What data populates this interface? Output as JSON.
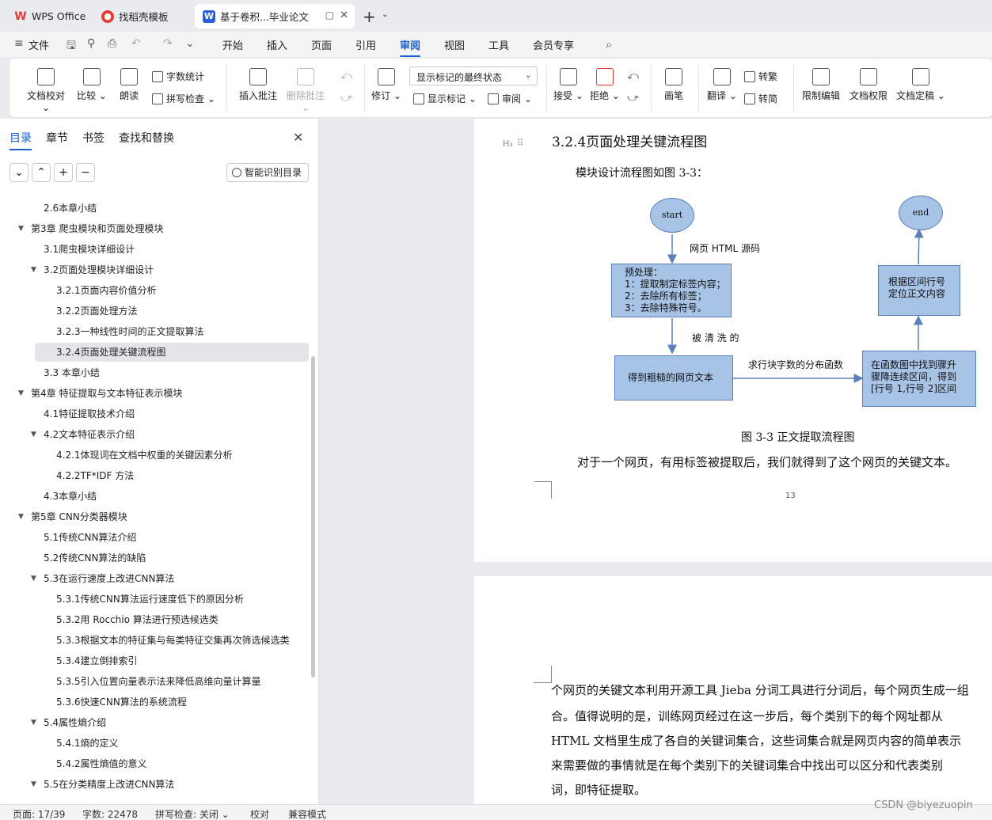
{
  "tabs": [
    {
      "label": "WPS Office",
      "icon": "wps-logo-icon",
      "color": "#e53935"
    },
    {
      "label": "找稻壳模板",
      "icon": "docer-icon",
      "color": "#e53935"
    },
    {
      "label": "基于卷积...毕业论文",
      "icon": "word-doc-icon",
      "color": "#2b5fd9"
    }
  ],
  "menu": {
    "file": "文件",
    "items": [
      "开始",
      "插入",
      "页面",
      "引用",
      "审阅",
      "视图",
      "工具",
      "会员专享"
    ],
    "active": "审阅"
  },
  "ribbon": {
    "proofread": "文档校对",
    "compare": "比较",
    "read_aloud": "朗读",
    "word_count": "字数统计",
    "spell_check": "拼写检查",
    "insert_comment": "插入批注",
    "delete_comment": "删除批注",
    "track_changes": "修订",
    "display_mode": "显示标记的最终状态",
    "show_markup": "显示标记",
    "review": "审阅",
    "accept": "接受",
    "reject": "拒绝",
    "pen": "画笔",
    "translate": "翻译",
    "to_traditional": "转繁",
    "to_simplified": "转简",
    "restrict_edit": "限制编辑",
    "doc_permission": "文档权限",
    "finalize": "文档定稿"
  },
  "nav_panel": {
    "tabs": [
      "目录",
      "章节",
      "书签",
      "查找和替换"
    ],
    "active_tab": "目录",
    "smart_toc": "智能识别目录",
    "buttons": [
      "⌄",
      "⌃",
      "+",
      "−"
    ],
    "toc": [
      {
        "text": "2.6本章小结",
        "level": 2
      },
      {
        "text": "第3章 爬虫模块和页面处理模块",
        "level": 1,
        "expanded": true
      },
      {
        "text": "3.1爬虫模块详细设计",
        "level": 2
      },
      {
        "text": "3.2页面处理模块详细设计",
        "level": 2,
        "expanded": true
      },
      {
        "text": "3.2.1页面内容价值分析",
        "level": 3
      },
      {
        "text": "3.2.2页面处理方法",
        "level": 3
      },
      {
        "text": "3.2.3一种线性时间的正文提取算法",
        "level": 3
      },
      {
        "text": "3.2.4页面处理关键流程图",
        "level": 3,
        "selected": true
      },
      {
        "text": "3.3 本章小结",
        "level": 2
      },
      {
        "text": "第4章 特征提取与文本特征表示模块",
        "level": 1,
        "expanded": true
      },
      {
        "text": "4.1特征提取技术介绍",
        "level": 2
      },
      {
        "text": "4.2文本特征表示介绍",
        "level": 2,
        "expanded": true
      },
      {
        "text": "4.2.1体现词在文档中权重的关键因素分析",
        "level": 3
      },
      {
        "text": "4.2.2TF*IDF 方法",
        "level": 3
      },
      {
        "text": "4.3本章小结",
        "level": 2
      },
      {
        "text": "第5章 CNN分类器模块",
        "level": 1,
        "expanded": true
      },
      {
        "text": "5.1传统CNN算法介绍",
        "level": 2
      },
      {
        "text": "5.2传统CNN算法的缺陷",
        "level": 2
      },
      {
        "text": "5.3在运行速度上改进CNN算法",
        "level": 2,
        "expanded": true
      },
      {
        "text": "5.3.1传统CNN算法运行速度低下的原因分析",
        "level": 3
      },
      {
        "text": "5.3.2用 Rocchio 算法进行预选候选类",
        "level": 3
      },
      {
        "text": "5.3.3根据文本的特征集与每类特征交集再次筛选候选类",
        "level": 3
      },
      {
        "text": "5.3.4建立倒排索引",
        "level": 3
      },
      {
        "text": "5.3.5引入位置向量表示法来降低高维向量计算量",
        "level": 3
      },
      {
        "text": "5.3.6快速CNN算法的系统流程",
        "level": 3
      },
      {
        "text": "5.4属性熵介绍",
        "level": 2,
        "expanded": true
      },
      {
        "text": "5.4.1熵的定义",
        "level": 3
      },
      {
        "text": "5.4.2属性熵值的意义",
        "level": 3
      },
      {
        "text": "5.5在分类精度上改进CNN算法",
        "level": 2,
        "expanded": true
      }
    ]
  },
  "document": {
    "heading": "3.2.4页面处理关键流程图",
    "heading_marker": "H₃",
    "intro": "模块设计流程图如图 3-3：",
    "caption": "图 3-3 正文提取流程图",
    "after_caption": "对于一个网页，有用标签被提取后，我们就得到了这个网页的关键文本。",
    "page_number": "13",
    "flowchart": {
      "start": "start",
      "end": "end",
      "label_html_source": "网页 HTML 源码",
      "preprocess": [
        "预处理：",
        "1：提取制定标签内容；",
        "2：去除所有标签；",
        "3：去除特殊符号。"
      ],
      "label_cleaned": "被 清 洗 的",
      "rough_text": "得到粗糙的网页文本",
      "label_block_count": "求行块字数的分布函数",
      "find_range": [
        "在函数图中找到骤升",
        "骤降连续区间，得到",
        "[行号 1,行号 2]区间"
      ],
      "locate_body": [
        "根据区间行号",
        "定位正文内容"
      ]
    },
    "page2_lines": [
      "个网页的关键文本利用开源工具 Jieba 分词工具进行分词后，每个网页生成一组",
      "合。值得说明的是，训练网页经过在这一步后，每个类别下的每个网址都从",
      "HTML 文档里生成了各自的关键词集合，这些词集合就是网页内容的简单表示",
      "来需要做的事情就是在每个类别下的关键词集合中找出可以区分和代表类别",
      "词，即特征提取。"
    ]
  },
  "status": {
    "page": "页面: 17/39",
    "word_count": "字数: 22478",
    "spell_check": "拼写检查: 关闭",
    "proofread": "校对",
    "compat_mode": "兼容模式"
  },
  "watermark": "CSDN @biyezuopin",
  "colors": {
    "accent": "#1a5fd6",
    "flow_fill": "#a7c3e6",
    "flow_stroke": "#5b7fb8"
  }
}
